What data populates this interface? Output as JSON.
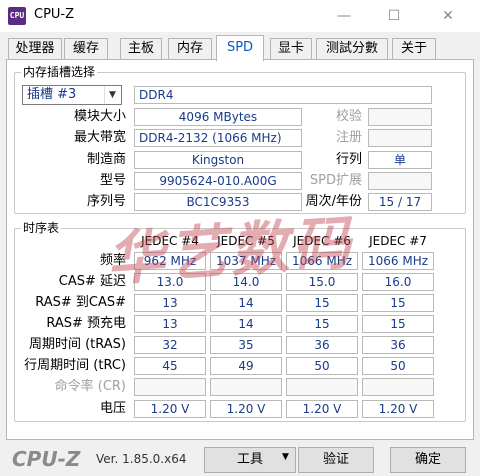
{
  "window": {
    "title": "CPU-Z",
    "icon_label": "CPU",
    "minimize_glyph": "—",
    "maximize_glyph": "☐",
    "close_glyph": "✕"
  },
  "tabs": [
    {
      "label": "处理器",
      "active": false
    },
    {
      "label": "缓存",
      "active": false
    },
    {
      "label": "主板",
      "active": false
    },
    {
      "label": "内存",
      "active": false
    },
    {
      "label": "SPD",
      "active": true
    },
    {
      "label": "显卡",
      "active": false
    },
    {
      "label": "测試分數",
      "active": false
    },
    {
      "label": "关于",
      "active": false
    }
  ],
  "slot_group": {
    "title": "内存插槽选择",
    "slot_select": "插槽 #3",
    "slot_arrow": "▼",
    "memory_type": "DDR4",
    "module_size_label": "模块大小",
    "module_size": "4096 MBytes",
    "max_bandwidth_label": "最大带宽",
    "max_bandwidth": "DDR4-2132 (1066 MHz)",
    "manufacturer_label": "制造商",
    "manufacturer": "Kingston",
    "part_number_label": "型号",
    "part_number": "9905624-010.A00G",
    "serial_label": "序列号",
    "serial": "BC1C9353",
    "correction_label": "校验",
    "correction": "",
    "registered_label": "注册",
    "registered": "",
    "ranks_label": "行列",
    "ranks": "单",
    "spd_ext_label": "SPD扩展",
    "spd_ext": "",
    "week_year_label": "周次/年份",
    "week_year": "15 / 17"
  },
  "timing_group": {
    "title": "时序表",
    "columns": [
      "JEDEC #4",
      "JEDEC #5",
      "JEDEC #6",
      "JEDEC #7"
    ],
    "rows": [
      {
        "label": "频率",
        "dim": false,
        "values": [
          "962 MHz",
          "1037 MHz",
          "1066 MHz",
          "1066 MHz"
        ]
      },
      {
        "label": "CAS# 延迟",
        "dim": false,
        "values": [
          "13.0",
          "14.0",
          "15.0",
          "16.0"
        ]
      },
      {
        "label": "RAS# 到CAS#",
        "dim": false,
        "values": [
          "13",
          "14",
          "15",
          "15"
        ]
      },
      {
        "label": "RAS# 预充电",
        "dim": false,
        "values": [
          "13",
          "14",
          "15",
          "15"
        ]
      },
      {
        "label": "周期时间 (tRAS)",
        "dim": false,
        "values": [
          "32",
          "35",
          "36",
          "36"
        ]
      },
      {
        "label": "行周期时间 (tRC)",
        "dim": false,
        "values": [
          "45",
          "49",
          "50",
          "50"
        ]
      },
      {
        "label": "命令率 (CR)",
        "dim": true,
        "values": [
          "",
          "",
          "",
          ""
        ]
      },
      {
        "label": "电压",
        "dim": false,
        "values": [
          "1.20 V",
          "1.20 V",
          "1.20 V",
          "1.20 V"
        ]
      }
    ]
  },
  "watermark": "华艺数码",
  "footer": {
    "logo": "CPU-Z",
    "version": "Ver. 1.85.0.x64",
    "tools_label": "工具",
    "tools_arrow": "▼",
    "validate_label": "验证",
    "ok_label": "确定"
  },
  "colors": {
    "value_text": "#1a3a8a",
    "active_tab_text": "#0a55c8",
    "watermark": "#be4650"
  }
}
